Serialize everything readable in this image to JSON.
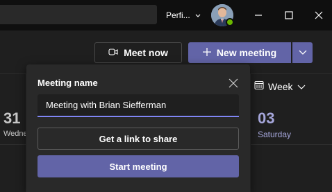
{
  "titlebar": {
    "org_name": "Perfi...",
    "avatar_status": "available"
  },
  "toolbar": {
    "meet_now_label": "Meet now",
    "new_meeting_label": "New meeting",
    "view_label": "Week"
  },
  "calendar": {
    "left_day_number": "31",
    "left_day_name": "Wedne",
    "right_day_number": "03",
    "right_day_name": "Saturday"
  },
  "popup": {
    "title": "Meeting name",
    "meeting_name_value": "Meeting with Brian Siefferman",
    "get_link_label": "Get a link to share",
    "start_label": "Start meeting"
  },
  "colors": {
    "accent": "#6264a7",
    "presence_available": "#6bb700",
    "input_underline": "#7f85f5"
  }
}
